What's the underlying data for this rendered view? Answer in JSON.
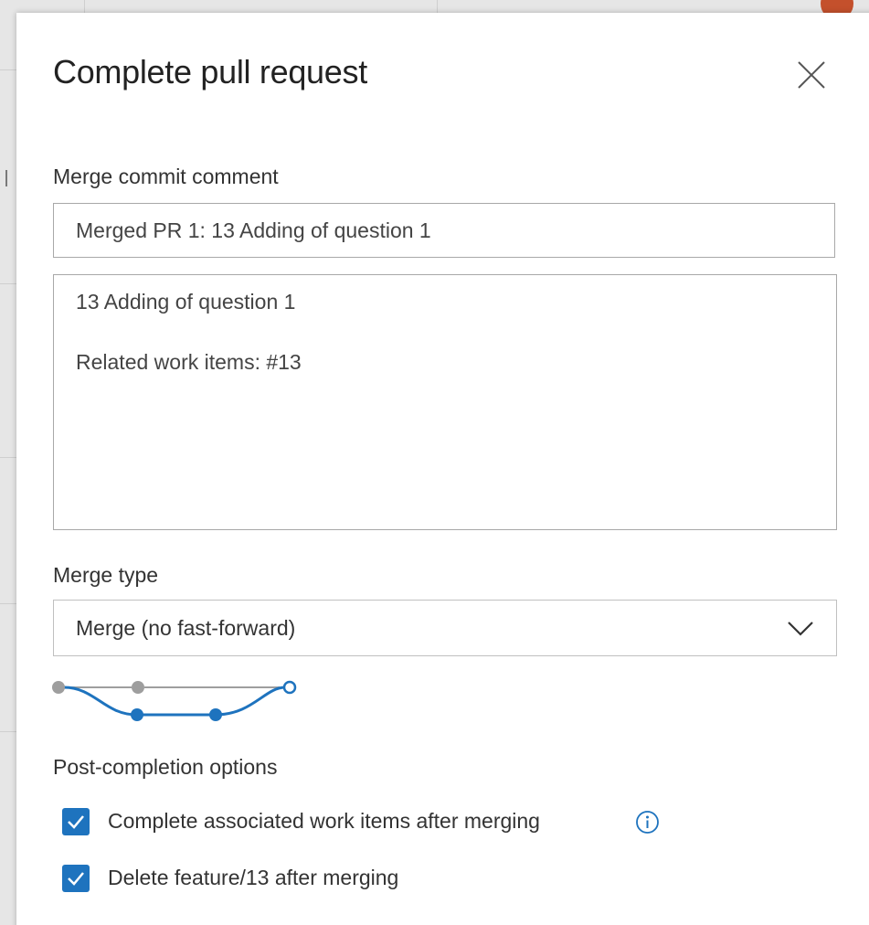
{
  "dialog": {
    "title": "Complete pull request",
    "close_icon": "close-icon"
  },
  "merge_commit": {
    "label": "Merge commit comment",
    "title_value": "Merged PR 1: 13 Adding of question 1",
    "body_lines": [
      "13 Adding of question 1",
      "Related work items: #13"
    ]
  },
  "merge_type": {
    "label": "Merge type",
    "selected": "Merge (no fast-forward)",
    "dropdown_icon": "chevron-down-icon"
  },
  "post_completion": {
    "label": "Post-completion options",
    "options": [
      {
        "label": "Complete associated work items after merging",
        "checked": true,
        "info_icon": "info-icon"
      },
      {
        "label": "Delete feature/13 after merging",
        "checked": true
      }
    ]
  },
  "colors": {
    "accent": "#1e73be",
    "branch_gray": "#9e9e9e",
    "branch_blue": "#1e73be"
  }
}
